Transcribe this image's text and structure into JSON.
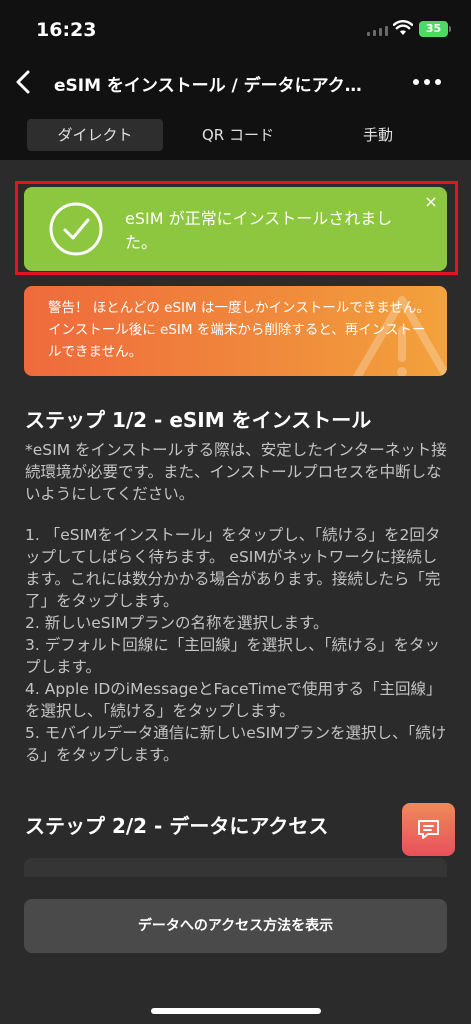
{
  "status_bar": {
    "time": "16:23",
    "battery": "35"
  },
  "nav": {
    "title": "eSIM をインストール / データにアク…"
  },
  "tabs": [
    {
      "label": "ダイレクト",
      "active": true
    },
    {
      "label": "QR コード",
      "active": false
    },
    {
      "label": "手動",
      "active": false
    }
  ],
  "success_alert": {
    "text": "eSIM が正常にインストールされました。",
    "close": "×"
  },
  "warning_alert": {
    "text": "警告！ ほとんどの eSIM は一度しかインストールできません。インストール後に eSIM を端末から削除すると、再インストールできません。"
  },
  "step1": {
    "heading": "ステップ 1/2 - eSIM をインストール",
    "note": "*eSIM をインストールする際は、安定したインターネット接続環境が必要です。また、インストールプロセスを中断しないようにしてください。",
    "steps": [
      "1. 「eSIMをインストール」をタップし、「続ける」を2回タップしてしばらく待ちます。 eSIMがネットワークに接続します。これには数分かかる場合があります。接続したら「完了」をタップします。",
      "2. 新しいeSIMプランの名称を選択します。",
      "3. デフォルト回線に「主回線」を選択し、「続ける」をタップします。",
      "4. Apple IDのiMessageとFaceTimeで使用する「主回線」を選択し、「続ける」をタップします。",
      "5. モバイルデータ通信に新しいeSIMプランを選択し、「続ける」をタップします。"
    ]
  },
  "step2": {
    "heading": "ステップ 2/2 - データにアクセス"
  },
  "bottom": {
    "button_label": "データへのアクセス方法を表示"
  },
  "colors": {
    "success": "#8dc63f",
    "warning_start": "#ef6a3c",
    "warning_end": "#f2a23c",
    "highlight": "#e3141f",
    "background": "#2b2b2b"
  },
  "icons": {
    "back": "chevron-left-icon",
    "more": "more-horizontal-icon",
    "check": "check-circle-icon",
    "close": "close-icon",
    "chat": "chat-icon"
  }
}
